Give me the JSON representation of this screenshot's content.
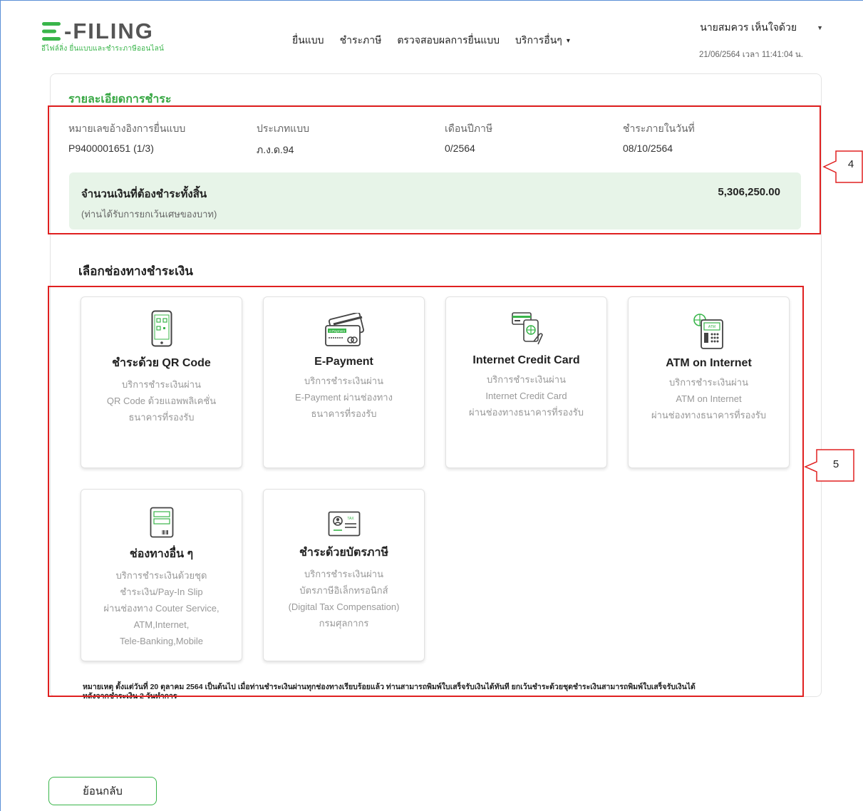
{
  "header": {
    "logo_text": "-FILING",
    "logo_subtitle": "อีไฟล์ลิ่ง ยื่นแบบและชำระภาษีออนไลน์",
    "nav": [
      {
        "label": "ยื่นแบบ"
      },
      {
        "label": "ชำระภาษี"
      },
      {
        "label": "ตรวจสอบผลการยื่นแบบ"
      },
      {
        "label": "บริการอื่นๆ"
      }
    ],
    "user_name": "นายสมควร เห็นใจด้วย",
    "datetime": "21/06/2564 เวลา 11:41:04 น."
  },
  "payment_details": {
    "title": "รายละเอียดการชำระ",
    "fields": [
      {
        "label": "หมายเลขอ้างอิงการยื่นแบบ",
        "value": "P9400001651 (1/3)"
      },
      {
        "label": "ประเภทแบบ",
        "value": "ภ.ง.ด.94"
      },
      {
        "label": "เดือนปีภาษี",
        "value": "0/2564"
      },
      {
        "label": "ชำระภายในวันที่",
        "value": "08/10/2564"
      }
    ],
    "total_label": "จำนวนเงินที่ต้องชำระทั้งสิ้น",
    "total_note": "(ท่านได้รับการยกเว้นเศษของบาท)",
    "total_value": "5,306,250.00"
  },
  "channels": {
    "title": "เลือกช่องทางชำระเงิน",
    "items": [
      {
        "title": "ชำระด้วย QR Code",
        "desc": [
          "บริการชำระเงินผ่าน",
          "QR Code ด้วยแอพพลิเคชั่น",
          "ธนาคารที่รองรับ"
        ],
        "icon": "qr-phone-icon"
      },
      {
        "title": "E-Payment",
        "desc": [
          "บริการชำระเงินผ่าน",
          "E-Payment ผ่านช่องทาง",
          "ธนาคารที่รองรับ"
        ],
        "icon": "card-icon",
        "icon_text": "e-Payment"
      },
      {
        "title": "Internet Credit Card",
        "desc": [
          "บริการชำระเงินผ่าน",
          "Internet Credit Card",
          "ผ่านช่องทางธนาคารที่รองรับ"
        ],
        "icon": "credit-card-hand-icon"
      },
      {
        "title": "ATM on Internet",
        "desc": [
          "บริการชำระเงินผ่าน",
          "ATM on Internet",
          "ผ่านช่องทางธนาคารที่รองรับ"
        ],
        "icon": "atm-globe-icon",
        "icon_text": "ATM"
      },
      {
        "title": "ช่องทางอื่น ๆ",
        "desc": [
          "บริการชำระเงินด้วยชุด",
          "ชำระเงิน/Pay-In Slip",
          "ผ่านช่องทาง Couter Service,",
          "ATM,Internet,",
          "Tele-Banking,Mobile"
        ],
        "icon": "pay-in-slip-icon"
      },
      {
        "title": "ชำระด้วยบัตรภาษี",
        "desc": [
          "บริการชำระเงินผ่าน",
          "บัตรภาษีอิเล็กทรอนิกส์",
          "(Digital Tax Compensation)",
          "กรมศุลกากร"
        ],
        "icon": "tax-card-icon",
        "icon_text": "TAX"
      }
    ],
    "note_line1": "หมายเหตุ ตั้งแต่วันที่ 20 ตุลาคม 2564 เป็นต้นไป เมื่อท่านชำระเงินผ่านทุกช่องทางเรียบร้อยแล้ว ท่านสามารถพิมพ์ใบเสร็จรับเงินได้ทันที ยกเว้นชำระด้วยชุดชำระเงินสามารถพิมพ์ใบเสร็จรับเงินได้",
    "note_line2": "หลังจากชำระเงิน 2 วันทำการ"
  },
  "annotations": {
    "callout_details": "4",
    "callout_channels": "5"
  },
  "back_button": "ย้อนกลับ",
  "colors": {
    "brand_green": "#39b54a",
    "annotation_red": "#e02020",
    "total_bg": "#e7f4e8"
  }
}
